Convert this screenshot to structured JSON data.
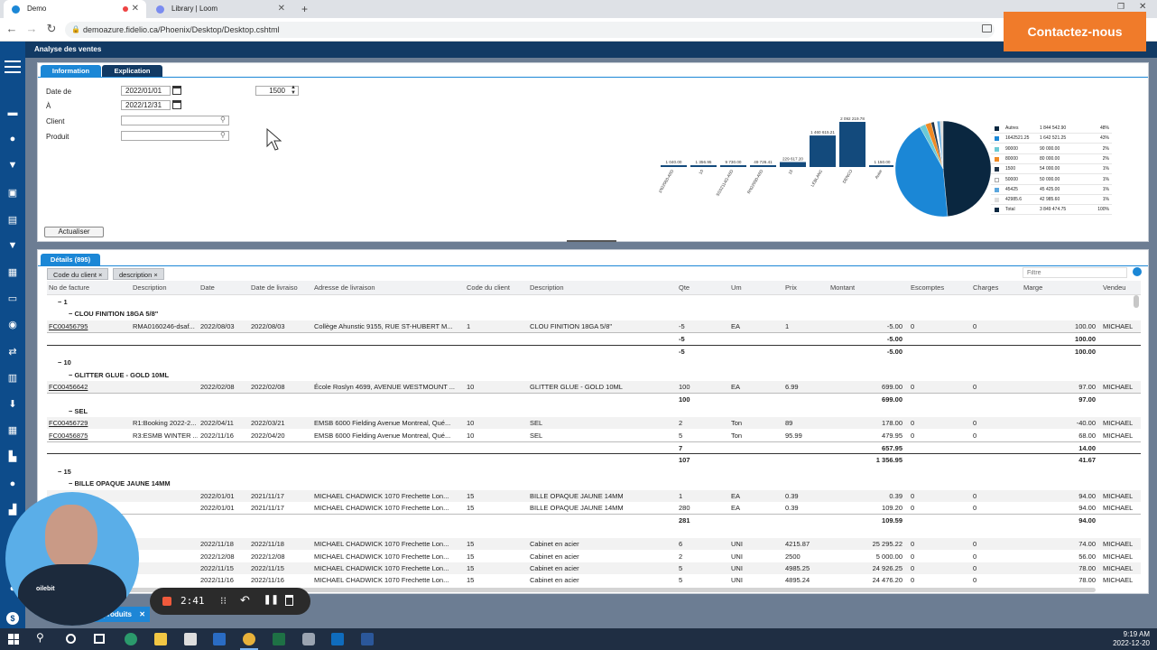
{
  "browser": {
    "tabs": [
      {
        "label": "Demo",
        "active": true
      },
      {
        "label": "Library | Loom",
        "active": false
      }
    ],
    "url": "demoazure.fidelio.ca/Phoenix/Desktop/Desktop.cshtml"
  },
  "cta": {
    "label": "Contactez-nous",
    "color": "#f07b2a"
  },
  "app": {
    "title": "Analyse des ventes"
  },
  "panel": {
    "tabs": [
      "Information",
      "Explication"
    ],
    "date_from_label": "Date de",
    "date_from": "2022/01/01",
    "date_to_label": "À",
    "date_to": "2022/12/31",
    "top_n": "1500",
    "client_label": "Client",
    "product_label": "Produit",
    "refresh": "Actualiser"
  },
  "chart_data": [
    {
      "type": "bar",
      "categories": [
        "1N22060-A6D",
        "10",
        "SSS2114G-A6D",
        "RN22090-A6D",
        "15",
        "LEBLANC",
        "DENCO",
        "Autre"
      ],
      "values": [
        1040.0,
        1356.95,
        9730.0,
        49726.41,
        229617.2,
        1460615.21,
        2092219.78,
        1150.0
      ],
      "value_labels": [
        "1 040.00",
        "1 356.95",
        "9 730.00",
        "49 726.41",
        "229 617.20",
        "1 460 615.21",
        "2 092 219.78",
        "1 150.00"
      ]
    },
    {
      "type": "pie",
      "legend": [
        {
          "name": "Autres",
          "value": "1 844 542.90",
          "pct": "48%",
          "color": "#0a2740"
        },
        {
          "name": "1642521.25",
          "value": "1 642 521.25",
          "pct": "43%",
          "color": "#1b87d6"
        },
        {
          "name": "90000",
          "value": "90 000.00",
          "pct": "2%",
          "color": "#6bcad6"
        },
        {
          "name": "80000",
          "value": "80 000.00",
          "pct": "2%",
          "color": "#f08a24"
        },
        {
          "name": "1500",
          "value": "54 000.00",
          "pct": "1%",
          "color": "#21354a"
        },
        {
          "name": "50000",
          "value": "50 000.00",
          "pct": "1%",
          "color": "#ffffff"
        },
        {
          "name": "45425",
          "value": "45 425.00",
          "pct": "1%",
          "color": "#5ba7de"
        },
        {
          "name": "42985.6",
          "value": "42 985.60",
          "pct": "1%",
          "color": "#dcdcdc"
        },
        {
          "name": "Total",
          "value": "3 849 474.75",
          "pct": "100%",
          "color": "#0a2740"
        }
      ],
      "slices": [
        48,
        43,
        2,
        2,
        1,
        1,
        1,
        1
      ]
    }
  ],
  "details": {
    "title": "Détails (895)",
    "chips": [
      "Code du client",
      "description"
    ],
    "filter_placeholder": "Filtre",
    "columns": [
      "No de facture",
      "Description",
      "Date",
      "Date de livraiso",
      "Adresse de livraison",
      "Code du client",
      "Description",
      "Qte",
      "Um",
      "Prix",
      "Montant",
      "Escomptes",
      "Charges",
      "Marge",
      "Vendeu"
    ],
    "rows": [
      {
        "kind": "grp",
        "indent": 12,
        "text": "− 1"
      },
      {
        "kind": "grp",
        "indent": 24,
        "text": "− CLOU FINITION 18GA 5/8\""
      },
      {
        "kind": "data",
        "alt": true,
        "c": [
          "FC00456795",
          "RMA0160246-dsaf...",
          "2022/08/03",
          "2022/08/03",
          "Collège Ahunstic 9155, RUE ST-HUBERT M...",
          "1",
          "CLOU FINITION 18GA 5/8\"",
          "-5",
          "EA",
          "1",
          "-5.00",
          "0",
          "0",
          "100.00",
          "MICHAEL"
        ]
      },
      {
        "kind": "tot",
        "c": [
          "-5",
          "-5.00",
          "100.00"
        ]
      },
      {
        "kind": "tot2",
        "c": [
          "-5",
          "-5.00",
          "100.00"
        ]
      },
      {
        "kind": "grp",
        "indent": 12,
        "text": "− 10"
      },
      {
        "kind": "grp",
        "indent": 24,
        "text": "− GLITTER GLUE - GOLD 10ML"
      },
      {
        "kind": "data",
        "alt": true,
        "c": [
          "FC00456642",
          "",
          "2022/02/08",
          "2022/02/08",
          "École Roslyn 4699, AVENUE WESTMOUNT ...",
          "10",
          "GLITTER GLUE - GOLD 10ML",
          "100",
          "EA",
          "6.99",
          "699.00",
          "0",
          "0",
          "97.00",
          "MICHAEL"
        ]
      },
      {
        "kind": "tot",
        "c": [
          "100",
          "699.00",
          "97.00"
        ]
      },
      {
        "kind": "grp",
        "indent": 24,
        "text": "− SEL"
      },
      {
        "kind": "data",
        "alt": true,
        "c": [
          "FC00456729",
          "R1:Booking 2022-2...",
          "2022/04/11",
          "2022/03/21",
          "EMSB 6000 Fielding Avenue Montreal, Qué...",
          "10",
          "SEL",
          "2",
          "Ton",
          "89",
          "178.00",
          "0",
          "0",
          "-40.00",
          "MICHAEL"
        ]
      },
      {
        "kind": "data",
        "alt": false,
        "c": [
          "FC00456875",
          "R3:ESMB WINTER ...",
          "2022/11/16",
          "2022/04/20",
          "EMSB 6000 Fielding Avenue Montreal, Qué...",
          "10",
          "SEL",
          "5",
          "Ton",
          "95.99",
          "479.95",
          "0",
          "0",
          "68.00",
          "MICHAEL"
        ]
      },
      {
        "kind": "tot",
        "c": [
          "7",
          "657.95",
          "14.00"
        ]
      },
      {
        "kind": "tot2",
        "c": [
          "107",
          "1 356.95",
          "41.67"
        ]
      },
      {
        "kind": "grp",
        "indent": 12,
        "text": "− 15"
      },
      {
        "kind": "grp",
        "indent": 24,
        "text": "− BILLE OPAQUE JAUNE 14MM"
      },
      {
        "kind": "data",
        "alt": true,
        "c": [
          "",
          "",
          "2022/01/01",
          "2021/11/17",
          "MICHAEL CHADWICK 1070 Frechette Lon...",
          "15",
          "BILLE OPAQUE JAUNE 14MM",
          "1",
          "EA",
          "0.39",
          "0.39",
          "0",
          "0",
          "94.00",
          "MICHAEL"
        ]
      },
      {
        "kind": "data",
        "alt": false,
        "c": [
          "",
          "",
          "2022/01/01",
          "2021/11/17",
          "MICHAEL CHADWICK 1070 Frechette Lon...",
          "15",
          "BILLE OPAQUE JAUNE 14MM",
          "280",
          "EA",
          "0.39",
          "109.20",
          "0",
          "0",
          "94.00",
          "MICHAEL"
        ]
      },
      {
        "kind": "tot",
        "c": [
          "281",
          "109.59",
          "94.00"
        ]
      },
      {
        "kind": "blank"
      },
      {
        "kind": "data",
        "alt": true,
        "c": [
          "",
          "",
          "2022/11/18",
          "2022/11/18",
          "MICHAEL CHADWICK 1070 Frechette Lon...",
          "15",
          "Cabinet en acier",
          "6",
          "UNI",
          "4215.87",
          "25 295.22",
          "0",
          "0",
          "74.00",
          "MICHAEL"
        ]
      },
      {
        "kind": "data",
        "alt": false,
        "c": [
          "",
          "",
          "2022/12/08",
          "2022/12/08",
          "MICHAEL CHADWICK 1070 Frechette Lon...",
          "15",
          "Cabinet en acier",
          "2",
          "UNI",
          "2500",
          "5 000.00",
          "0",
          "0",
          "56.00",
          "MICHAEL"
        ]
      },
      {
        "kind": "data",
        "alt": true,
        "c": [
          "",
          "",
          "2022/11/15",
          "2022/11/15",
          "MICHAEL CHADWICK 1070 Frechette Lon...",
          "15",
          "Cabinet en acier",
          "5",
          "UNI",
          "4985.25",
          "24 926.25",
          "0",
          "0",
          "78.00",
          "MICHAEL"
        ]
      },
      {
        "kind": "data",
        "alt": false,
        "c": [
          "",
          "",
          "2022/11/16",
          "2022/11/16",
          "MICHAEL CHADWICK 1070 Frechette Lon...",
          "15",
          "Cabinet en acier",
          "5",
          "UNI",
          "4895.24",
          "24 476.20",
          "0",
          "0",
          "78.00",
          "MICHAEL"
        ]
      }
    ]
  },
  "bottom_tab": {
    "label": "produits"
  },
  "loom": {
    "timer": "2:41",
    "badge": "oilebit"
  },
  "taskbar": {
    "time": "9:19 AM",
    "date": "2022-12-20"
  }
}
